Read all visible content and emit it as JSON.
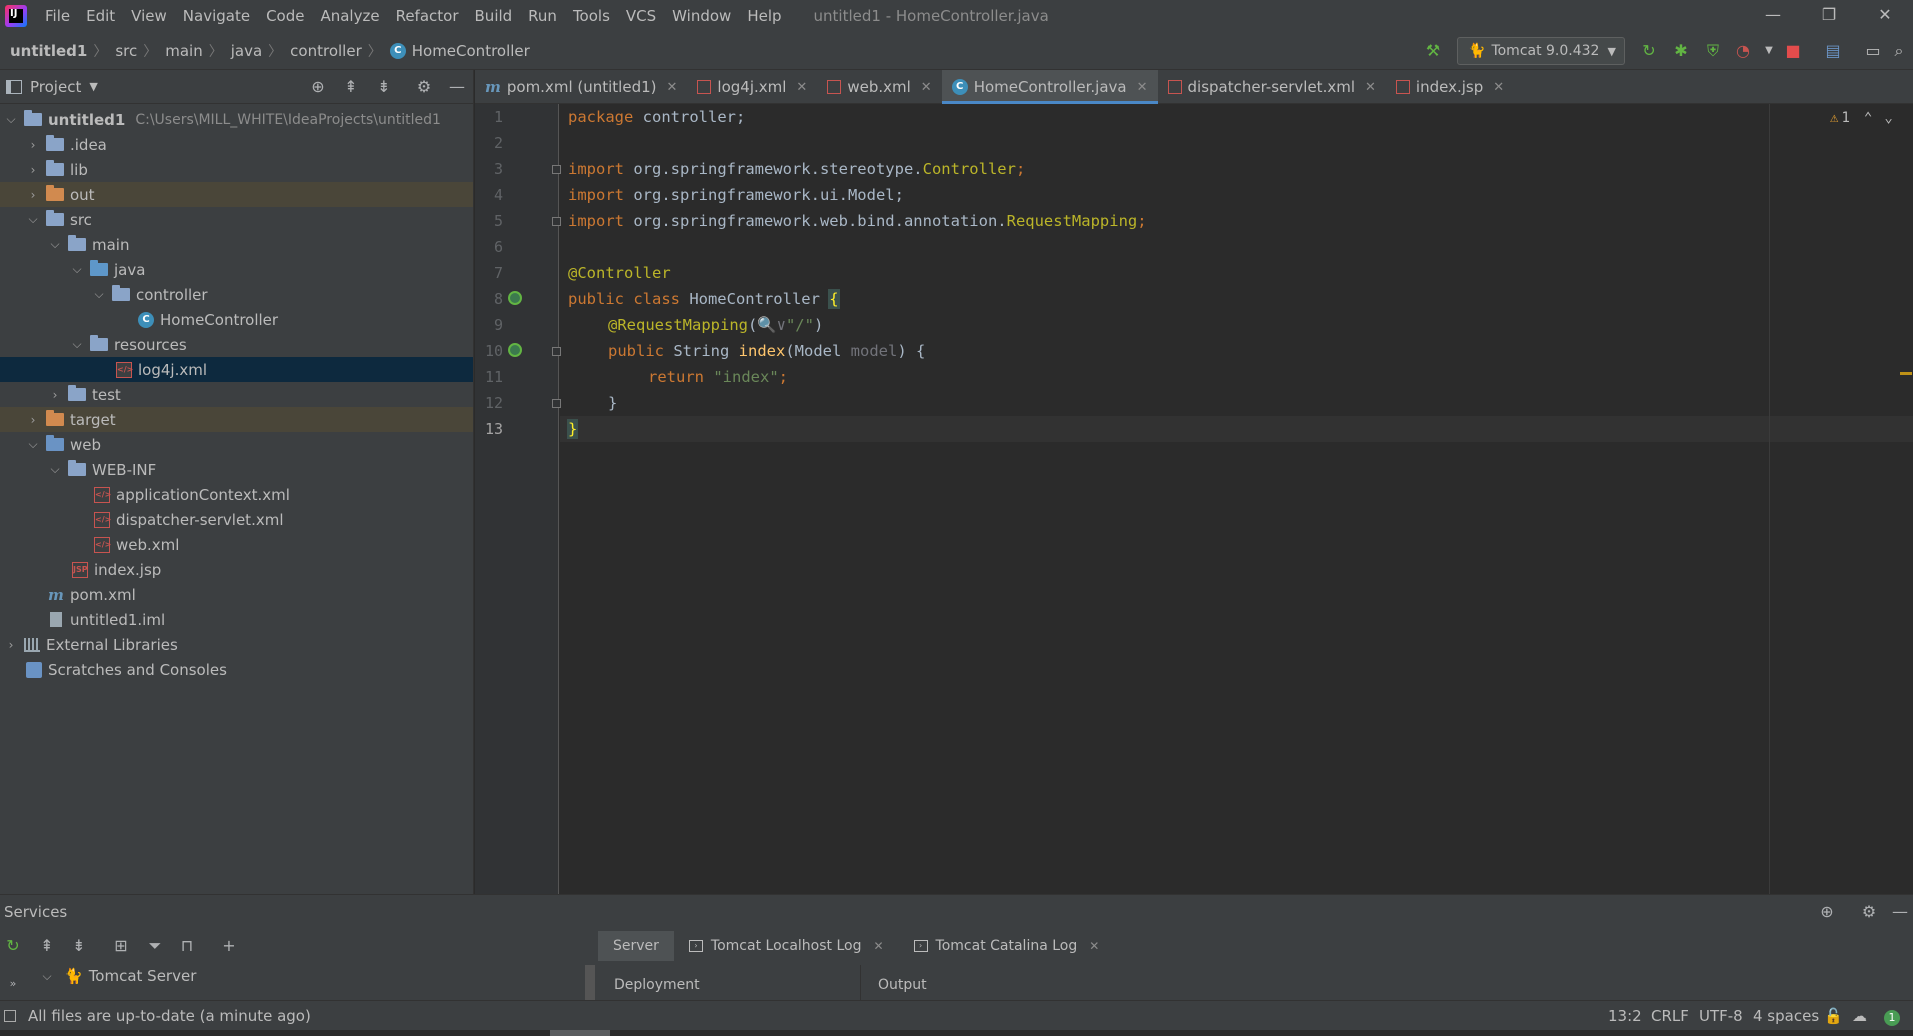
{
  "menubar": {
    "logo_text": "IJ",
    "items": [
      "File",
      "Edit",
      "View",
      "Navigate",
      "Code",
      "Analyze",
      "Refactor",
      "Build",
      "Run",
      "Tools",
      "VCS",
      "Window",
      "Help"
    ],
    "window_title": "untitled1 - HomeController.java"
  },
  "breadcrumb": [
    "untitled1",
    "src",
    "main",
    "java",
    "controller",
    "HomeController"
  ],
  "run_config": {
    "label": "Tomcat 9.0.432"
  },
  "project_panel": {
    "title": "Project",
    "tree": [
      {
        "label": "untitled1",
        "hint": "C:\\Users\\MILL_WHITE\\IdeaProjects\\untitled1"
      },
      {
        "label": ".idea"
      },
      {
        "label": "lib"
      },
      {
        "label": "out"
      },
      {
        "label": "src"
      },
      {
        "label": "main"
      },
      {
        "label": "java"
      },
      {
        "label": "controller"
      },
      {
        "label": "HomeController"
      },
      {
        "label": "resources"
      },
      {
        "label": "log4j.xml"
      },
      {
        "label": "test"
      },
      {
        "label": "target"
      },
      {
        "label": "web"
      },
      {
        "label": "WEB-INF"
      },
      {
        "label": "applicationContext.xml"
      },
      {
        "label": "dispatcher-servlet.xml"
      },
      {
        "label": "web.xml"
      },
      {
        "label": "index.jsp"
      },
      {
        "label": "pom.xml"
      },
      {
        "label": "untitled1.iml"
      },
      {
        "label": "External Libraries"
      },
      {
        "label": "Scratches and Consoles"
      }
    ]
  },
  "editor_tabs": [
    {
      "label": "pom.xml (untitled1)"
    },
    {
      "label": "log4j.xml"
    },
    {
      "label": "web.xml"
    },
    {
      "label": "HomeController.java"
    },
    {
      "label": "dispatcher-servlet.xml"
    },
    {
      "label": "index.jsp"
    }
  ],
  "editor": {
    "line_numbers": [
      "1",
      "2",
      "3",
      "4",
      "5",
      "6",
      "7",
      "8",
      "9",
      "10",
      "11",
      "12",
      "13"
    ],
    "warning_count": "1",
    "code": {
      "l1_kw": "package",
      "l1_rest": " controller;",
      "l3_kw": "import",
      "l3_pkg": " org.springframework.stereotype.",
      "l3_cls": "Controller",
      "l4_kw": "import",
      "l4_rest": " org.springframework.ui.Model;",
      "l5_kw": "import",
      "l5_pkg": " org.springframework.web.bind.annotation.",
      "l5_cls": "RequestMapping",
      "l7_ann": "@Controller",
      "l8_kw": "public class",
      "l8_name": " HomeController ",
      "l8_brace": "{",
      "l9_ann": "@RequestMapping",
      "l9_open": "(",
      "l9_icon": "🔍∨",
      "l9_str": "\"/\"",
      "l9_close": ")",
      "l10_kw": "public",
      "l10_type": " String ",
      "l10_fn": "index",
      "l10_params": "(Model ",
      "l10_param": "model",
      "l10_end": ") {",
      "l11_kw": "return",
      "l11_str": " \"index\"",
      "l11_end": ";",
      "l12": "}",
      "l13": "}"
    }
  },
  "services": {
    "title": "Services",
    "tabs": [
      {
        "label": "Server"
      },
      {
        "label": "Tomcat Localhost Log"
      },
      {
        "label": "Tomcat Catalina Log"
      }
    ],
    "tree_root": "Tomcat Server",
    "col_deployment": "Deployment",
    "col_output": "Output"
  },
  "statusbar": {
    "message": "All files are up-to-date (a minute ago)",
    "position": "13:2",
    "line_sep": "CRLF",
    "encoding": "UTF-8",
    "indent": "4 spaces",
    "notifications": "1"
  },
  "colors": {
    "accent": "#4a88c7",
    "keyword": "#cc7832",
    "annotation": "#bbb529",
    "string": "#6a8759",
    "function": "#ffc66d",
    "warning": "#f0a732"
  }
}
